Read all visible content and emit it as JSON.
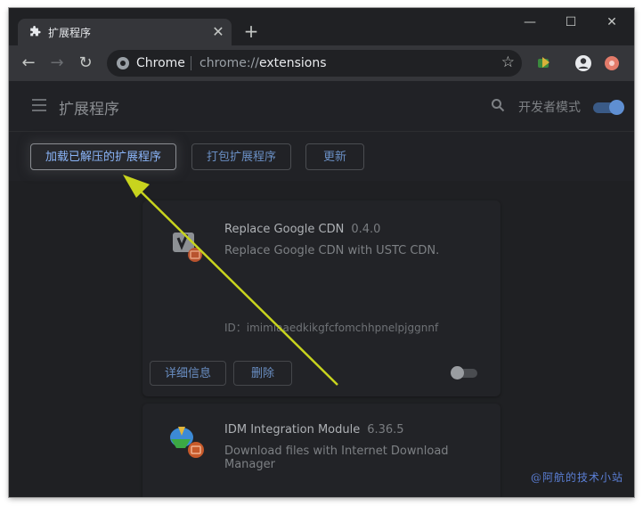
{
  "tab": {
    "title": "扩展程序",
    "close": "✕"
  },
  "window": {
    "new_tab": "+",
    "minimize": "—",
    "maximize": "☐",
    "close": "✕"
  },
  "toolbar": {
    "site_name": "Chrome",
    "url_scheme": "chrome://",
    "url_path": "extensions",
    "bookmark_icon": "star-icon"
  },
  "header": {
    "title": "扩展程序",
    "dev_mode_label": "开发者模式",
    "dev_mode_on": true
  },
  "actions": {
    "load_unpacked": "加载已解压的扩展程序",
    "pack": "打包扩展程序",
    "update": "更新"
  },
  "extensions": [
    {
      "name": "Replace Google CDN",
      "version": "0.4.0",
      "description": "Replace Google CDN with USTC CDN.",
      "id_label": "ID：",
      "id": "imimiaaedkikgfcfomchhpnelpjggnnf",
      "details": "详细信息",
      "remove": "删除",
      "enabled": false
    },
    {
      "name": "IDM Integration Module",
      "version": "6.36.5",
      "description": "Download files with Internet Download Manager"
    }
  ],
  "watermark": "@阿航的技术小站",
  "colors": {
    "accent": "#8ab4f8",
    "annotation_arrow": "#c8d41e"
  }
}
